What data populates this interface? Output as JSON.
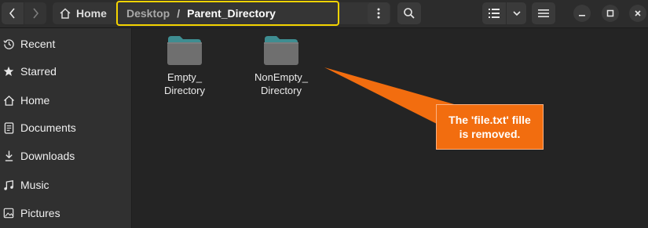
{
  "header": {
    "back_icon": "chevron-left-icon",
    "forward_icon": "chevron-right-icon",
    "breadcrumb": {
      "home_label": "Home",
      "home_icon": "home-icon",
      "separator": "/",
      "desktop_label": "Desktop",
      "current_label": "Parent_Directory"
    },
    "menu_icon": "vertical-dots-icon",
    "search_icon": "search-icon",
    "view_icon": "list-view-icon",
    "view_dropdown_icon": "chevron-down-icon",
    "hamburger_icon": "hamburger-menu-icon",
    "window_controls": {
      "minimize_icon": "minimize-icon",
      "maximize_icon": "maximize-icon",
      "close_icon": "close-icon"
    },
    "highlight_color": "#f5d400"
  },
  "sidebar": {
    "items": [
      {
        "label": "Recent",
        "icon": "clock-icon"
      },
      {
        "label": "Starred",
        "icon": "star-icon"
      },
      {
        "label": "Home",
        "icon": "home-icon"
      },
      {
        "label": "Documents",
        "icon": "document-icon"
      },
      {
        "label": "Downloads",
        "icon": "download-icon"
      },
      {
        "label": "Music",
        "icon": "music-note-icon"
      },
      {
        "label": "Pictures",
        "icon": "image-icon"
      }
    ]
  },
  "main": {
    "files": [
      {
        "name_line1": "Empty_",
        "name_line2": "Directory",
        "icon": "folder-icon"
      },
      {
        "name_line1": "NonEmpty_",
        "name_line2": "Directory",
        "icon": "folder-icon"
      }
    ]
  },
  "callout": {
    "text": "The 'file.txt' fille\nis removed.",
    "color": "#f26d0f"
  }
}
